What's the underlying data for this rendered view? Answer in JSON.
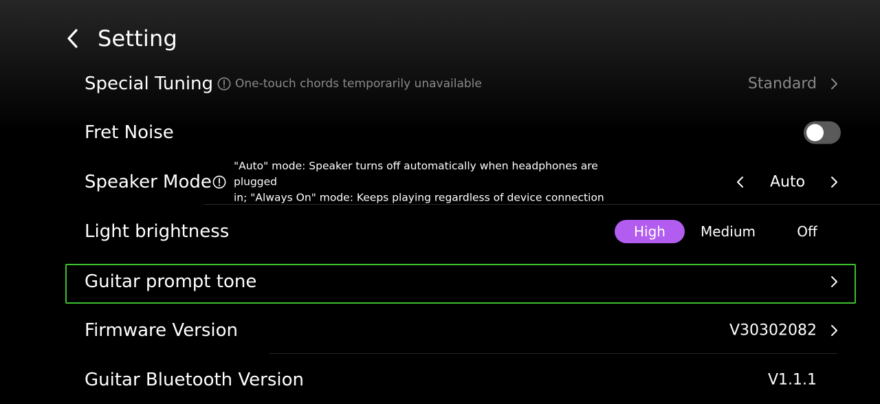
{
  "header": {
    "title": "Setting",
    "back_icon": "chevron-left-icon"
  },
  "rows": {
    "special_tuning": {
      "label": "Special Tuning",
      "hint": "One-touch chords temporarily unavailable",
      "value": "Standard"
    },
    "fret_noise": {
      "label": "Fret Noise",
      "toggle_on": false
    },
    "speaker_mode": {
      "label": "Speaker Mode",
      "description_line1": "\"Auto\" mode: Speaker turns off automatically when headphones are plugged",
      "description_line2": "in; \"Always On\" mode: Keeps playing regardless of device connection",
      "value": "Auto"
    },
    "light_brightness": {
      "label": "Light brightness",
      "options": [
        "High",
        "Medium",
        "Off"
      ],
      "selected": "High"
    },
    "guitar_prompt_tone": {
      "label": "Guitar prompt tone"
    },
    "firmware_version": {
      "label": "Firmware Version",
      "value": "V30302082"
    },
    "bluetooth_version": {
      "label": "Guitar Bluetooth Version",
      "value": "V1.1.1"
    }
  },
  "colors": {
    "accent": "#b25df0",
    "focus_outline": "#3fbf2f",
    "secondary_text": "#8a8a8a",
    "toggle_off": "#5a5a5a"
  }
}
